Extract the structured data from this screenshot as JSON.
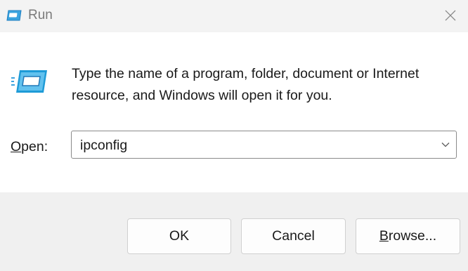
{
  "window": {
    "title": "Run",
    "close_icon": "close-icon",
    "title_icon": "run-app-icon"
  },
  "content": {
    "icon": "run-app-icon",
    "description": "Type the name of a program, folder, document or Internet resource, and Windows will open it for you.",
    "open_label_mnemonic": "O",
    "open_label_rest": "pen:",
    "combo_value": "ipconfig",
    "combo_arrow_icon": "chevron-down-icon"
  },
  "buttons": {
    "ok": "OK",
    "cancel": "Cancel",
    "browse_mnemonic": "B",
    "browse_rest": "rowse..."
  },
  "colors": {
    "accent": "#1e9bd7",
    "window_bg": "#f0f0f0",
    "content_bg": "#ffffff"
  }
}
